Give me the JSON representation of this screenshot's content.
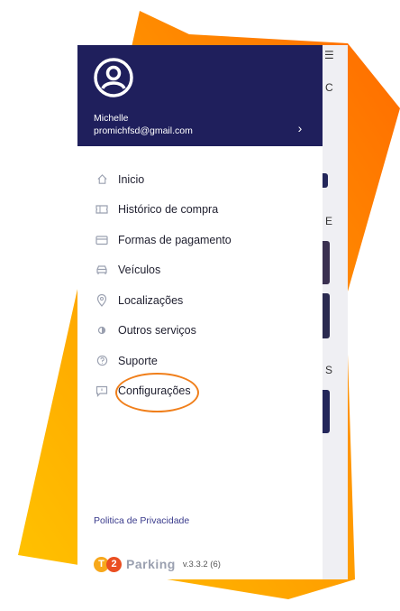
{
  "user": {
    "name": "Michelle",
    "email": "promichfsd@gmail.com"
  },
  "menu": {
    "items": [
      {
        "label": "Inicio",
        "icon": "home-icon"
      },
      {
        "label": "Histórico de compra",
        "icon": "ticket-icon"
      },
      {
        "label": "Formas de pagamento",
        "icon": "credit-card-icon"
      },
      {
        "label": "Veículos",
        "icon": "car-icon"
      },
      {
        "label": "Localizações",
        "icon": "location-pin-icon"
      },
      {
        "label": "Outros serviços",
        "icon": "services-icon"
      },
      {
        "label": "Suporte",
        "icon": "help-icon"
      },
      {
        "label": "Configurações",
        "icon": "chat-icon"
      }
    ]
  },
  "footer": {
    "privacy_link": "Politica de Privacidade",
    "brand_t": "T",
    "brand_2": "2",
    "brand_name": "Parking",
    "version": "v.3.3.2 (6)"
  },
  "background_page": {
    "letters": [
      "C",
      "E",
      "S"
    ]
  },
  "colors": {
    "header_bg": "#1f1f5c",
    "accent_orange": "#f07f1b",
    "link_color": "#3a3b8c"
  }
}
